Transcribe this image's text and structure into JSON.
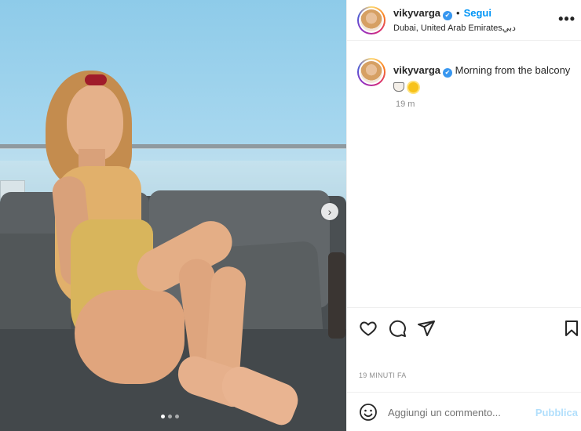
{
  "post": {
    "username": "vikyvarga",
    "verified_icon": "✔",
    "follow_label": "Segui",
    "bullet": "•",
    "location": "Dubai, United Arab Emiratesدبي",
    "more_icon": "•••",
    "caption_text": "Morning from the balcony",
    "caption_time": "19 m",
    "timestamp": "19 MINUTI FA",
    "comment_placeholder": "Aggiungi un commento...",
    "publish_label": "Pubblica",
    "carousel": {
      "total": 3,
      "active_index": 0,
      "next_arrow": "›"
    }
  },
  "icons": {
    "like": "heart-icon",
    "comment": "comment-bubble-icon",
    "share": "paper-plane-icon",
    "save": "bookmark-icon",
    "emoji": "smiley-icon"
  },
  "colors": {
    "follow": "#0095f6",
    "verified": "#3897f0",
    "publish_disabled": "#b2dffc",
    "muted_text": "#8e8e8e"
  }
}
